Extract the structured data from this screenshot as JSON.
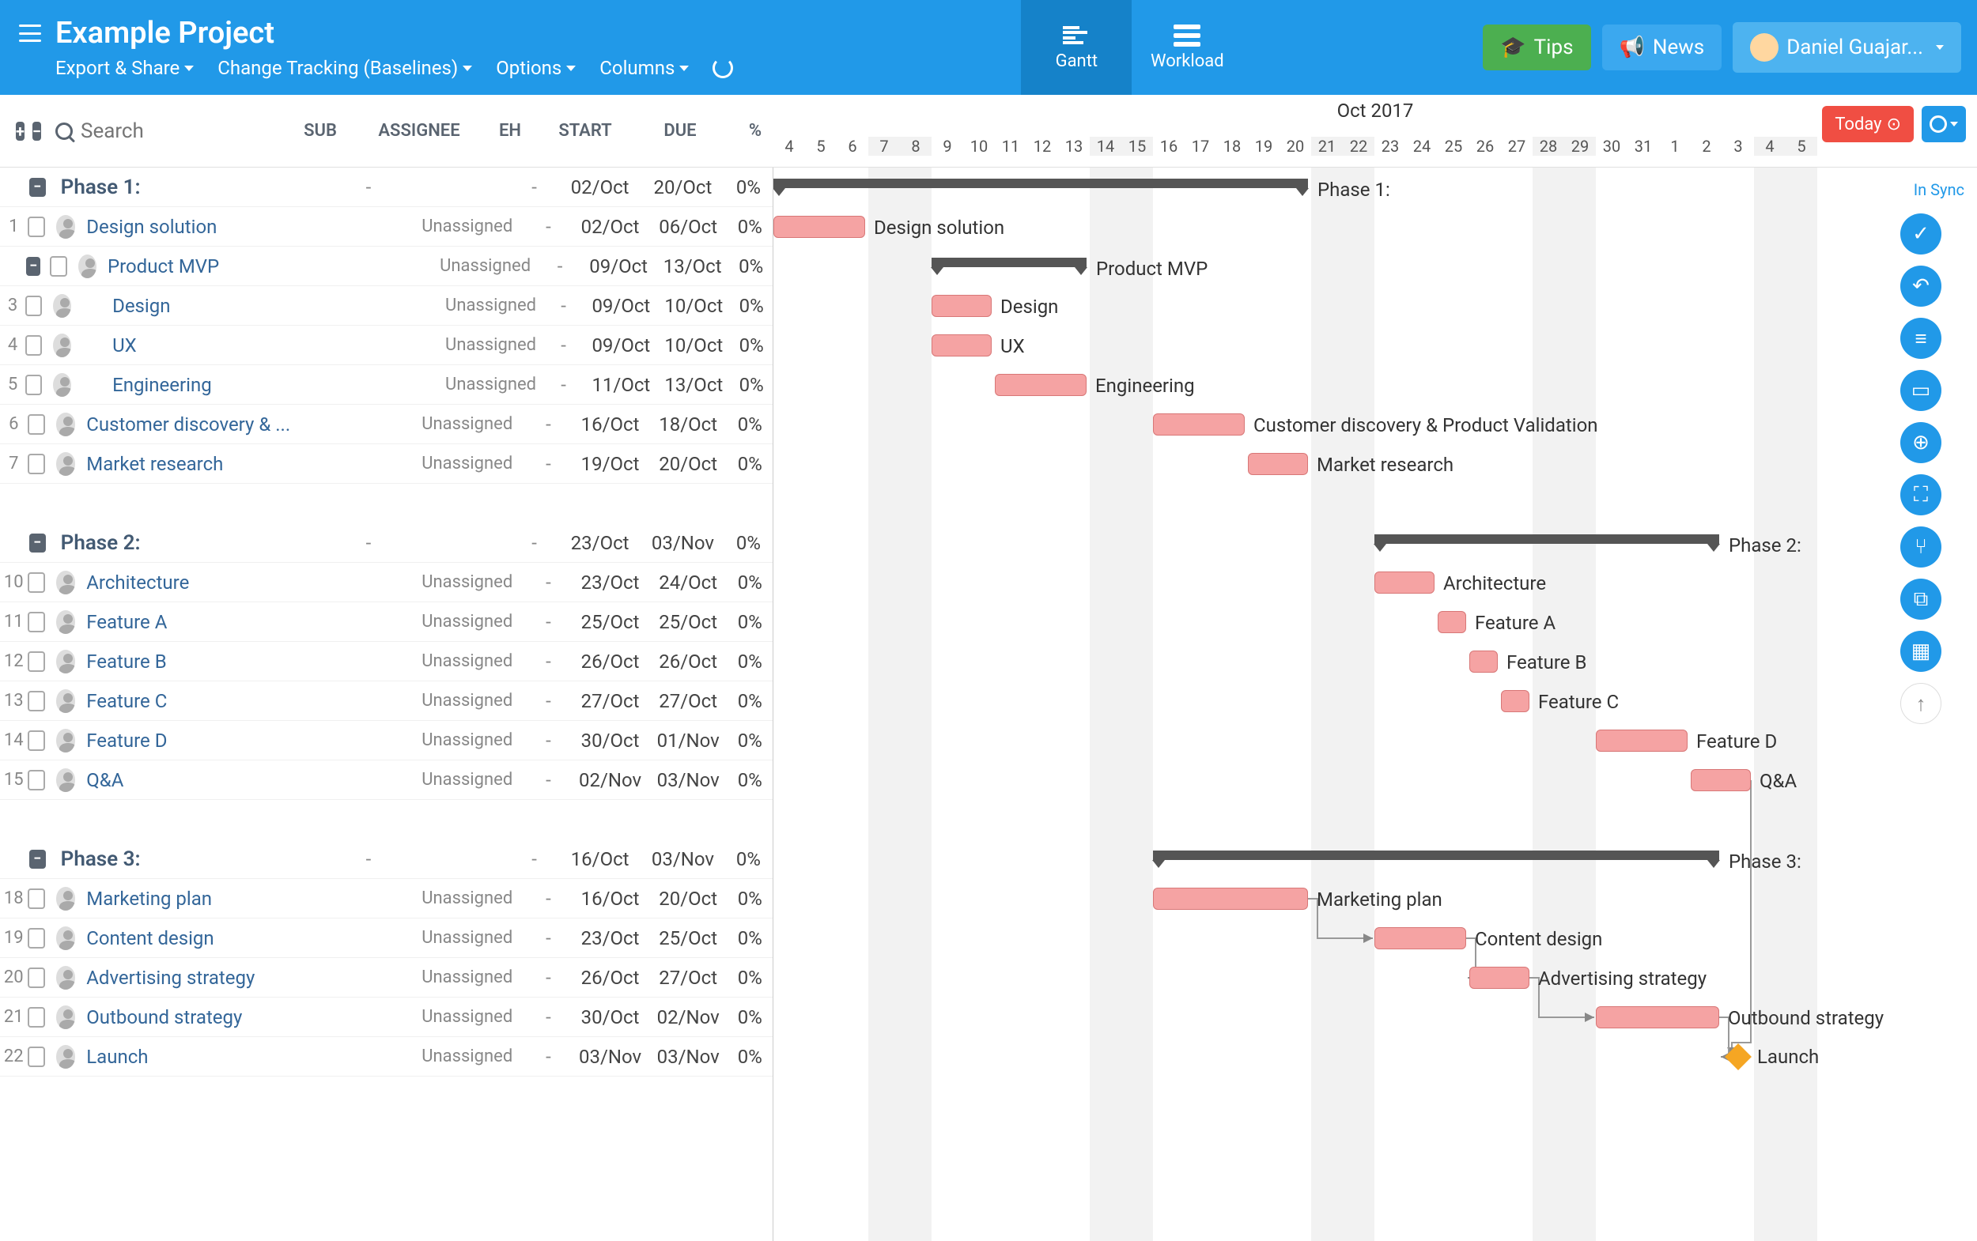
{
  "header": {
    "title": "Example Project",
    "subnav": {
      "export": "Export & Share",
      "tracking": "Change Tracking (Baselines)",
      "options": "Options",
      "columns": "Columns"
    },
    "views": {
      "gantt": "Gantt",
      "workload": "Workload"
    },
    "buttons": {
      "tips": "Tips",
      "news": "News"
    },
    "user": "Daniel Guajar..."
  },
  "toolbar": {
    "search_placeholder": "Search",
    "columns": {
      "sub": "SUB",
      "assignee": "ASSIGNEE",
      "eh": "EH",
      "start": "START",
      "due": "DUE",
      "pct": "%"
    },
    "month": "Oct 2017",
    "today": "Today",
    "sync": "In Sync"
  },
  "days": [
    {
      "n": "4",
      "w": false
    },
    {
      "n": "5",
      "w": false
    },
    {
      "n": "6",
      "w": false
    },
    {
      "n": "7",
      "w": true
    },
    {
      "n": "8",
      "w": true
    },
    {
      "n": "9",
      "w": false
    },
    {
      "n": "10",
      "w": false
    },
    {
      "n": "11",
      "w": false
    },
    {
      "n": "12",
      "w": false
    },
    {
      "n": "13",
      "w": false
    },
    {
      "n": "14",
      "w": true
    },
    {
      "n": "15",
      "w": true
    },
    {
      "n": "16",
      "w": false
    },
    {
      "n": "17",
      "w": false
    },
    {
      "n": "18",
      "w": false
    },
    {
      "n": "19",
      "w": false
    },
    {
      "n": "20",
      "w": false
    },
    {
      "n": "21",
      "w": true
    },
    {
      "n": "22",
      "w": true
    },
    {
      "n": "23",
      "w": false
    },
    {
      "n": "24",
      "w": false
    },
    {
      "n": "25",
      "w": false
    },
    {
      "n": "26",
      "w": false
    },
    {
      "n": "27",
      "w": false
    },
    {
      "n": "28",
      "w": true
    },
    {
      "n": "29",
      "w": true
    },
    {
      "n": "30",
      "w": false
    },
    {
      "n": "31",
      "w": false
    },
    {
      "n": "1",
      "w": false
    },
    {
      "n": "2",
      "w": false
    },
    {
      "n": "3",
      "w": false
    },
    {
      "n": "4",
      "w": true
    },
    {
      "n": "5",
      "w": true
    }
  ],
  "rows": [
    {
      "type": "phase",
      "collapse": true,
      "name": "Phase 1:",
      "sub": "-",
      "eh": "-",
      "start": "02/Oct",
      "due": "20/Oct",
      "pct": "0%",
      "bar": {
        "kind": "summary",
        "d0": 0,
        "d1": 17
      }
    },
    {
      "type": "task",
      "num": "1",
      "name": "Design solution",
      "assignee": "Unassigned",
      "sub": "",
      "eh": "-",
      "start": "02/Oct",
      "due": "06/Oct",
      "pct": "0%",
      "bar": {
        "kind": "task",
        "d0": 0,
        "d1": 3
      }
    },
    {
      "type": "task",
      "num": "",
      "collapse": true,
      "name": "Product MVP",
      "assignee": "Unassigned",
      "sub": "",
      "eh": "-",
      "start": "09/Oct",
      "due": "13/Oct",
      "pct": "0%",
      "bar": {
        "kind": "summary",
        "d0": 5,
        "d1": 10
      }
    },
    {
      "type": "task",
      "num": "3",
      "indent": 1,
      "name": "Design",
      "assignee": "Unassigned",
      "sub": "",
      "eh": "-",
      "start": "09/Oct",
      "due": "10/Oct",
      "pct": "0%",
      "bar": {
        "kind": "task",
        "d0": 5,
        "d1": 7
      }
    },
    {
      "type": "task",
      "num": "4",
      "indent": 1,
      "name": "UX",
      "assignee": "Unassigned",
      "sub": "",
      "eh": "-",
      "start": "09/Oct",
      "due": "10/Oct",
      "pct": "0%",
      "bar": {
        "kind": "task",
        "d0": 5,
        "d1": 7
      }
    },
    {
      "type": "task",
      "num": "5",
      "indent": 1,
      "name": "Engineering",
      "assignee": "Unassigned",
      "sub": "",
      "eh": "-",
      "start": "11/Oct",
      "due": "13/Oct",
      "pct": "0%",
      "bar": {
        "kind": "task",
        "d0": 7,
        "d1": 10
      }
    },
    {
      "type": "task",
      "num": "6",
      "name": "Customer discovery & ...",
      "fullname": "Customer discovery & Product Validation",
      "assignee": "Unassigned",
      "sub": "",
      "eh": "-",
      "start": "16/Oct",
      "due": "18/Oct",
      "pct": "0%",
      "bar": {
        "kind": "task",
        "d0": 12,
        "d1": 15
      }
    },
    {
      "type": "task",
      "num": "7",
      "name": "Market research",
      "assignee": "Unassigned",
      "sub": "",
      "eh": "-",
      "start": "19/Oct",
      "due": "20/Oct",
      "pct": "0%",
      "bar": {
        "kind": "task",
        "d0": 15,
        "d1": 17
      }
    },
    {
      "type": "spacer"
    },
    {
      "type": "phase",
      "collapse": true,
      "name": "Phase 2:",
      "sub": "-",
      "eh": "-",
      "start": "23/Oct",
      "due": "03/Nov",
      "pct": "0%",
      "bar": {
        "kind": "summary",
        "d0": 19,
        "d1": 30
      }
    },
    {
      "type": "task",
      "num": "10",
      "name": "Architecture",
      "assignee": "Unassigned",
      "sub": "",
      "eh": "-",
      "start": "23/Oct",
      "due": "24/Oct",
      "pct": "0%",
      "bar": {
        "kind": "task",
        "d0": 19,
        "d1": 21
      }
    },
    {
      "type": "task",
      "num": "11",
      "name": "Feature A",
      "assignee": "Unassigned",
      "sub": "",
      "eh": "-",
      "start": "25/Oct",
      "due": "25/Oct",
      "pct": "0%",
      "bar": {
        "kind": "task",
        "d0": 21,
        "d1": 22
      }
    },
    {
      "type": "task",
      "num": "12",
      "name": "Feature B",
      "assignee": "Unassigned",
      "sub": "",
      "eh": "-",
      "start": "26/Oct",
      "due": "26/Oct",
      "pct": "0%",
      "bar": {
        "kind": "task",
        "d0": 22,
        "d1": 23
      }
    },
    {
      "type": "task",
      "num": "13",
      "name": "Feature C",
      "assignee": "Unassigned",
      "sub": "",
      "eh": "-",
      "start": "27/Oct",
      "due": "27/Oct",
      "pct": "0%",
      "bar": {
        "kind": "task",
        "d0": 23,
        "d1": 24
      }
    },
    {
      "type": "task",
      "num": "14",
      "name": "Feature D",
      "assignee": "Unassigned",
      "sub": "",
      "eh": "-",
      "start": "30/Oct",
      "due": "01/Nov",
      "pct": "0%",
      "bar": {
        "kind": "task",
        "d0": 26,
        "d1": 29
      }
    },
    {
      "type": "task",
      "num": "15",
      "name": "Q&A",
      "assignee": "Unassigned",
      "sub": "",
      "eh": "-",
      "start": "02/Nov",
      "due": "03/Nov",
      "pct": "0%",
      "bar": {
        "kind": "task",
        "d0": 29,
        "d1": 31
      }
    },
    {
      "type": "spacer"
    },
    {
      "type": "phase",
      "collapse": true,
      "name": "Phase 3:",
      "sub": "-",
      "eh": "-",
      "start": "16/Oct",
      "due": "03/Nov",
      "pct": "0%",
      "bar": {
        "kind": "summary",
        "d0": 12,
        "d1": 30
      }
    },
    {
      "type": "task",
      "num": "18",
      "name": "Marketing plan",
      "assignee": "Unassigned",
      "sub": "",
      "eh": "-",
      "start": "16/Oct",
      "due": "20/Oct",
      "pct": "0%",
      "bar": {
        "kind": "task",
        "d0": 12,
        "d1": 17
      }
    },
    {
      "type": "task",
      "num": "19",
      "name": "Content design",
      "assignee": "Unassigned",
      "sub": "",
      "eh": "-",
      "start": "23/Oct",
      "due": "25/Oct",
      "pct": "0%",
      "bar": {
        "kind": "task",
        "d0": 19,
        "d1": 22
      }
    },
    {
      "type": "task",
      "num": "20",
      "name": "Advertising strategy",
      "assignee": "Unassigned",
      "sub": "",
      "eh": "-",
      "start": "26/Oct",
      "due": "27/Oct",
      "pct": "0%",
      "bar": {
        "kind": "task",
        "d0": 22,
        "d1": 24
      }
    },
    {
      "type": "task",
      "num": "21",
      "name": "Outbound strategy",
      "assignee": "Unassigned",
      "sub": "",
      "eh": "-",
      "start": "30/Oct",
      "due": "02/Nov",
      "pct": "0%",
      "bar": {
        "kind": "task",
        "d0": 26,
        "d1": 30
      }
    },
    {
      "type": "task",
      "num": "22",
      "name": "Launch",
      "assignee": "Unassigned",
      "sub": "",
      "eh": "-",
      "start": "03/Nov",
      "due": "03/Nov",
      "pct": "0%",
      "bar": {
        "kind": "milestone",
        "d0": 30
      }
    }
  ],
  "dependencies": [
    {
      "from": 15,
      "to": 22,
      "fromDay": 31,
      "toDay": 30
    },
    {
      "from": 18,
      "to": 19,
      "fromDay": 17,
      "toDay": 19
    },
    {
      "from": 19,
      "to": 20,
      "fromDay": 22,
      "toDay": 22
    },
    {
      "from": 20,
      "to": 21,
      "fromDay": 24,
      "toDay": 26
    },
    {
      "from": 21,
      "to": 22,
      "fromDay": 30,
      "toDay": 30
    }
  ],
  "colors": {
    "primary": "#2199e8",
    "task_bar": "#f5a3a3",
    "summary_bar": "#555555",
    "milestone": "#f5a623",
    "tips": "#4caf50",
    "today": "#f04e43"
  }
}
